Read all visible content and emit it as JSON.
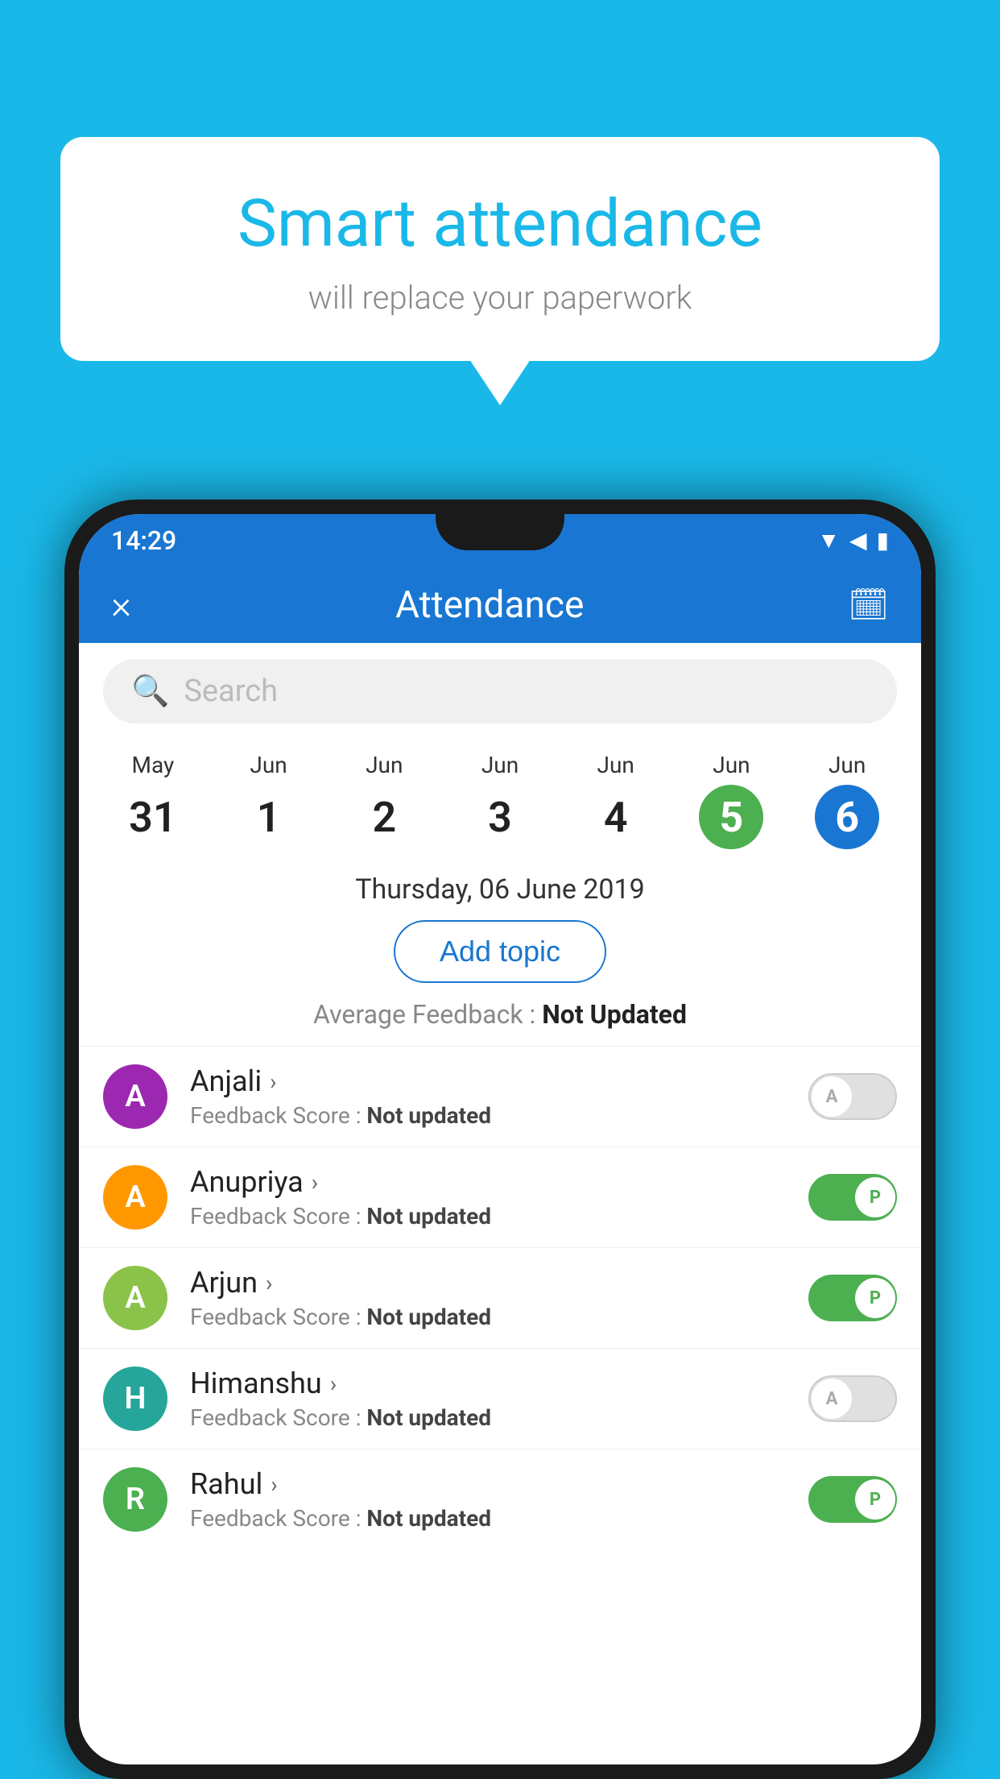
{
  "background_color": "#1ab8e8",
  "speech_bubble": {
    "title": "Smart attendance",
    "subtitle": "will replace your paperwork"
  },
  "status_bar": {
    "time": "14:29",
    "icons": [
      "wifi",
      "signal",
      "battery"
    ]
  },
  "header": {
    "title": "Attendance",
    "close_label": "×",
    "calendar_label": "📅"
  },
  "search": {
    "placeholder": "Search"
  },
  "calendar": {
    "dates": [
      {
        "month": "May",
        "day": "31",
        "style": "normal"
      },
      {
        "month": "Jun",
        "day": "1",
        "style": "normal"
      },
      {
        "month": "Jun",
        "day": "2",
        "style": "normal"
      },
      {
        "month": "Jun",
        "day": "3",
        "style": "normal"
      },
      {
        "month": "Jun",
        "day": "4",
        "style": "normal"
      },
      {
        "month": "Jun",
        "day": "5",
        "style": "green"
      },
      {
        "month": "Jun",
        "day": "6",
        "style": "blue"
      }
    ],
    "selected_date": "Thursday, 06 June 2019"
  },
  "add_topic_label": "Add topic",
  "average_feedback": {
    "label": "Average Feedback :",
    "value": "Not Updated"
  },
  "students": [
    {
      "name": "Anjali",
      "avatar_letter": "A",
      "avatar_color": "purple",
      "feedback_label": "Feedback Score :",
      "feedback_value": "Not updated",
      "toggle": "off",
      "toggle_letter": "A"
    },
    {
      "name": "Anupriya",
      "avatar_letter": "A",
      "avatar_color": "orange",
      "feedback_label": "Feedback Score :",
      "feedback_value": "Not updated",
      "toggle": "on",
      "toggle_letter": "P"
    },
    {
      "name": "Arjun",
      "avatar_letter": "A",
      "avatar_color": "light-green",
      "feedback_label": "Feedback Score :",
      "feedback_value": "Not updated",
      "toggle": "on",
      "toggle_letter": "P"
    },
    {
      "name": "Himanshu",
      "avatar_letter": "H",
      "avatar_color": "teal",
      "feedback_label": "Feedback Score :",
      "feedback_value": "Not updated",
      "toggle": "off",
      "toggle_letter": "A"
    },
    {
      "name": "Rahul",
      "avatar_letter": "R",
      "avatar_color": "green",
      "feedback_label": "Feedback Score :",
      "feedback_value": "Not updated",
      "toggle": "on",
      "toggle_letter": "P"
    }
  ]
}
